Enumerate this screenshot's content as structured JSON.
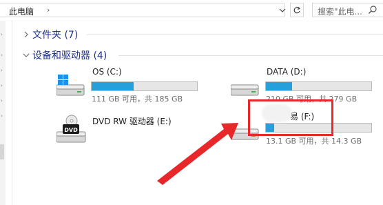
{
  "address_bar": {
    "path": "此电脑",
    "separator": "›",
    "dropdown_icon": "chevron-down-icon",
    "refresh_icon": "refresh-icon"
  },
  "search": {
    "placeholder": "搜索\"此电...",
    "icon": "search-icon"
  },
  "groups": {
    "folders": {
      "label": "文件夹 (7)",
      "expanded": false
    },
    "devices": {
      "label": "设备和驱动器 (4)",
      "expanded": true
    }
  },
  "drives": [
    {
      "name": "OS (C:)",
      "space": "111 GB 可用，共 185 GB",
      "used_fraction": 0.4,
      "icon": "windows-drive-icon"
    },
    {
      "name": "DATA (D:)",
      "space": "210 GB 可用，共 279 GB",
      "used_fraction": 0.25,
      "icon": "hard-drive-icon"
    },
    {
      "name": "DVD RW 驱动器 (E:)",
      "icon": "dvd-drive-icon"
    },
    {
      "name": "易 (F:)",
      "space": "13.1 GB 可用，共 14.3 GB",
      "used_fraction": 0.08,
      "icon": "usb-drive-icon"
    }
  ],
  "colors": {
    "group_label": "#1e3287",
    "bar_fill": "#26a0da",
    "bar_track": "#e6e6e6",
    "annotation": "#e8272a"
  }
}
